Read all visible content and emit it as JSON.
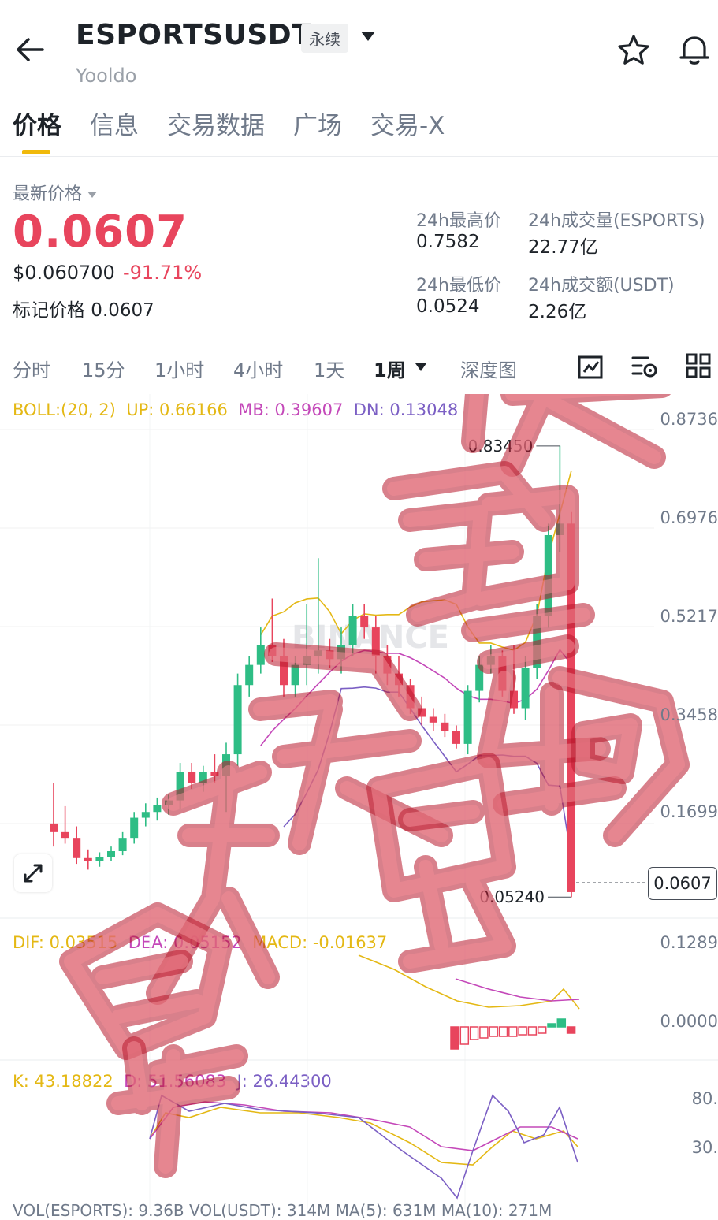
{
  "header": {
    "symbol": "ESPORTSUSDT",
    "contract_type": "永续",
    "subtitle": "Yooldo"
  },
  "tabs": [
    "价格",
    "信息",
    "交易数据",
    "广场",
    "交易-X"
  ],
  "price_panel": {
    "latest_label": "最新价格",
    "price": "0.0607",
    "usd_price": "$0.060700",
    "change": "-91.71%",
    "mark_price": "标记价格 0.0607"
  },
  "stats": {
    "high_label": "24h最高价",
    "high": "0.7582",
    "vol_label": "24h成交量(ESPORTS)",
    "vol": "22.77亿",
    "low_label": "24h最低价",
    "low": "0.0524",
    "turnover_label": "24h成交额(USDT)",
    "turnover": "2.26亿"
  },
  "intervals": [
    "分时",
    "15分",
    "1小时",
    "4小时",
    "1天",
    "1周",
    "深度图"
  ],
  "active_interval": "1周",
  "indicators": {
    "boll_name": "BOLL:(20, 2)",
    "boll_up": "UP: 0.66166",
    "boll_mb": "MB: 0.39607",
    "boll_dn": "DN: 0.13048",
    "macd_dif": "DIF: 0.03515",
    "macd_dea": "DEA: 0.05152",
    "macd_val": "MACD: -0.01637",
    "kdj_k": "K: 43.18822",
    "kdj_d": "D: 51.56083",
    "kdj_j": "J: 26.44300",
    "vol_line": "VOL(ESPORTS): 9.36B   VOL(USDT): 314M   MA(5): 631M   MA(10): 271M"
  },
  "axis": {
    "main": [
      "0.8736",
      "0.6976",
      "0.5217",
      "0.3458",
      "0.1699"
    ],
    "macd": [
      "0.1289",
      "0.0000"
    ],
    "kdj": [
      "80.",
      "30."
    ]
  },
  "annotations": {
    "high_marker": "0.83450",
    "low_marker": "0.05240",
    "current_price": "0.0607"
  },
  "watermark_text": "BINANCE",
  "overlay_text": "天天赚钱 暴跌割韭菜",
  "colors": {
    "up": "#2ebd85",
    "down": "#e8455d",
    "accent": "#f0b90b",
    "boll_up": "#e4b814",
    "boll_mb": "#c448b9",
    "boll_dn": "#7b5fc4"
  },
  "chart_data": {
    "type": "candlestick",
    "ylim": [
      0.05,
      0.9
    ],
    "candles": [
      {
        "o": 0.18,
        "h": 0.25,
        "l": 0.14,
        "c": 0.165
      },
      {
        "o": 0.165,
        "h": 0.21,
        "l": 0.145,
        "c": 0.155
      },
      {
        "o": 0.155,
        "h": 0.175,
        "l": 0.11,
        "c": 0.12
      },
      {
        "o": 0.12,
        "h": 0.135,
        "l": 0.1,
        "c": 0.115
      },
      {
        "o": 0.115,
        "h": 0.13,
        "l": 0.105,
        "c": 0.122
      },
      {
        "o": 0.122,
        "h": 0.14,
        "l": 0.115,
        "c": 0.132
      },
      {
        "o": 0.132,
        "h": 0.165,
        "l": 0.125,
        "c": 0.155
      },
      {
        "o": 0.155,
        "h": 0.2,
        "l": 0.145,
        "c": 0.19
      },
      {
        "o": 0.19,
        "h": 0.215,
        "l": 0.175,
        "c": 0.2
      },
      {
        "o": 0.2,
        "h": 0.225,
        "l": 0.185,
        "c": 0.212
      },
      {
        "o": 0.212,
        "h": 0.23,
        "l": 0.195,
        "c": 0.22
      },
      {
        "o": 0.22,
        "h": 0.285,
        "l": 0.205,
        "c": 0.27
      },
      {
        "o": 0.27,
        "h": 0.285,
        "l": 0.24,
        "c": 0.25
      },
      {
        "o": 0.25,
        "h": 0.28,
        "l": 0.235,
        "c": 0.27
      },
      {
        "o": 0.27,
        "h": 0.3,
        "l": 0.25,
        "c": 0.262
      },
      {
        "o": 0.262,
        "h": 0.32,
        "l": 0.2,
        "c": 0.3
      },
      {
        "o": 0.3,
        "h": 0.44,
        "l": 0.28,
        "c": 0.42
      },
      {
        "o": 0.42,
        "h": 0.47,
        "l": 0.4,
        "c": 0.455
      },
      {
        "o": 0.455,
        "h": 0.52,
        "l": 0.44,
        "c": 0.49
      },
      {
        "o": 0.49,
        "h": 0.57,
        "l": 0.46,
        "c": 0.47
      },
      {
        "o": 0.47,
        "h": 0.5,
        "l": 0.4,
        "c": 0.42
      },
      {
        "o": 0.42,
        "h": 0.47,
        "l": 0.4,
        "c": 0.455
      },
      {
        "o": 0.455,
        "h": 0.56,
        "l": 0.42,
        "c": 0.47
      },
      {
        "o": 0.47,
        "h": 0.64,
        "l": 0.44,
        "c": 0.48
      },
      {
        "o": 0.48,
        "h": 0.5,
        "l": 0.45,
        "c": 0.465
      },
      {
        "o": 0.465,
        "h": 0.52,
        "l": 0.44,
        "c": 0.49
      },
      {
        "o": 0.49,
        "h": 0.56,
        "l": 0.47,
        "c": 0.54
      },
      {
        "o": 0.54,
        "h": 0.56,
        "l": 0.5,
        "c": 0.52
      },
      {
        "o": 0.52,
        "h": 0.54,
        "l": 0.44,
        "c": 0.47
      },
      {
        "o": 0.47,
        "h": 0.49,
        "l": 0.42,
        "c": 0.44
      },
      {
        "o": 0.44,
        "h": 0.47,
        "l": 0.4,
        "c": 0.42
      },
      {
        "o": 0.42,
        "h": 0.43,
        "l": 0.37,
        "c": 0.38
      },
      {
        "o": 0.38,
        "h": 0.4,
        "l": 0.35,
        "c": 0.365
      },
      {
        "o": 0.365,
        "h": 0.38,
        "l": 0.34,
        "c": 0.355
      },
      {
        "o": 0.355,
        "h": 0.37,
        "l": 0.33,
        "c": 0.34
      },
      {
        "o": 0.34,
        "h": 0.35,
        "l": 0.31,
        "c": 0.318
      },
      {
        "o": 0.318,
        "h": 0.42,
        "l": 0.3,
        "c": 0.41
      },
      {
        "o": 0.41,
        "h": 0.47,
        "l": 0.39,
        "c": 0.455
      },
      {
        "o": 0.455,
        "h": 0.49,
        "l": 0.44,
        "c": 0.47
      },
      {
        "o": 0.47,
        "h": 0.48,
        "l": 0.4,
        "c": 0.41
      },
      {
        "o": 0.41,
        "h": 0.49,
        "l": 0.37,
        "c": 0.38
      },
      {
        "o": 0.38,
        "h": 0.47,
        "l": 0.36,
        "c": 0.45
      },
      {
        "o": 0.45,
        "h": 0.56,
        "l": 0.43,
        "c": 0.54
      },
      {
        "o": 0.54,
        "h": 0.7,
        "l": 0.52,
        "c": 0.68
      },
      {
        "o": 0.68,
        "h": 0.835,
        "l": 0.65,
        "c": 0.7
      },
      {
        "o": 0.7,
        "h": 0.72,
        "l": 0.052,
        "c": 0.061
      }
    ]
  }
}
